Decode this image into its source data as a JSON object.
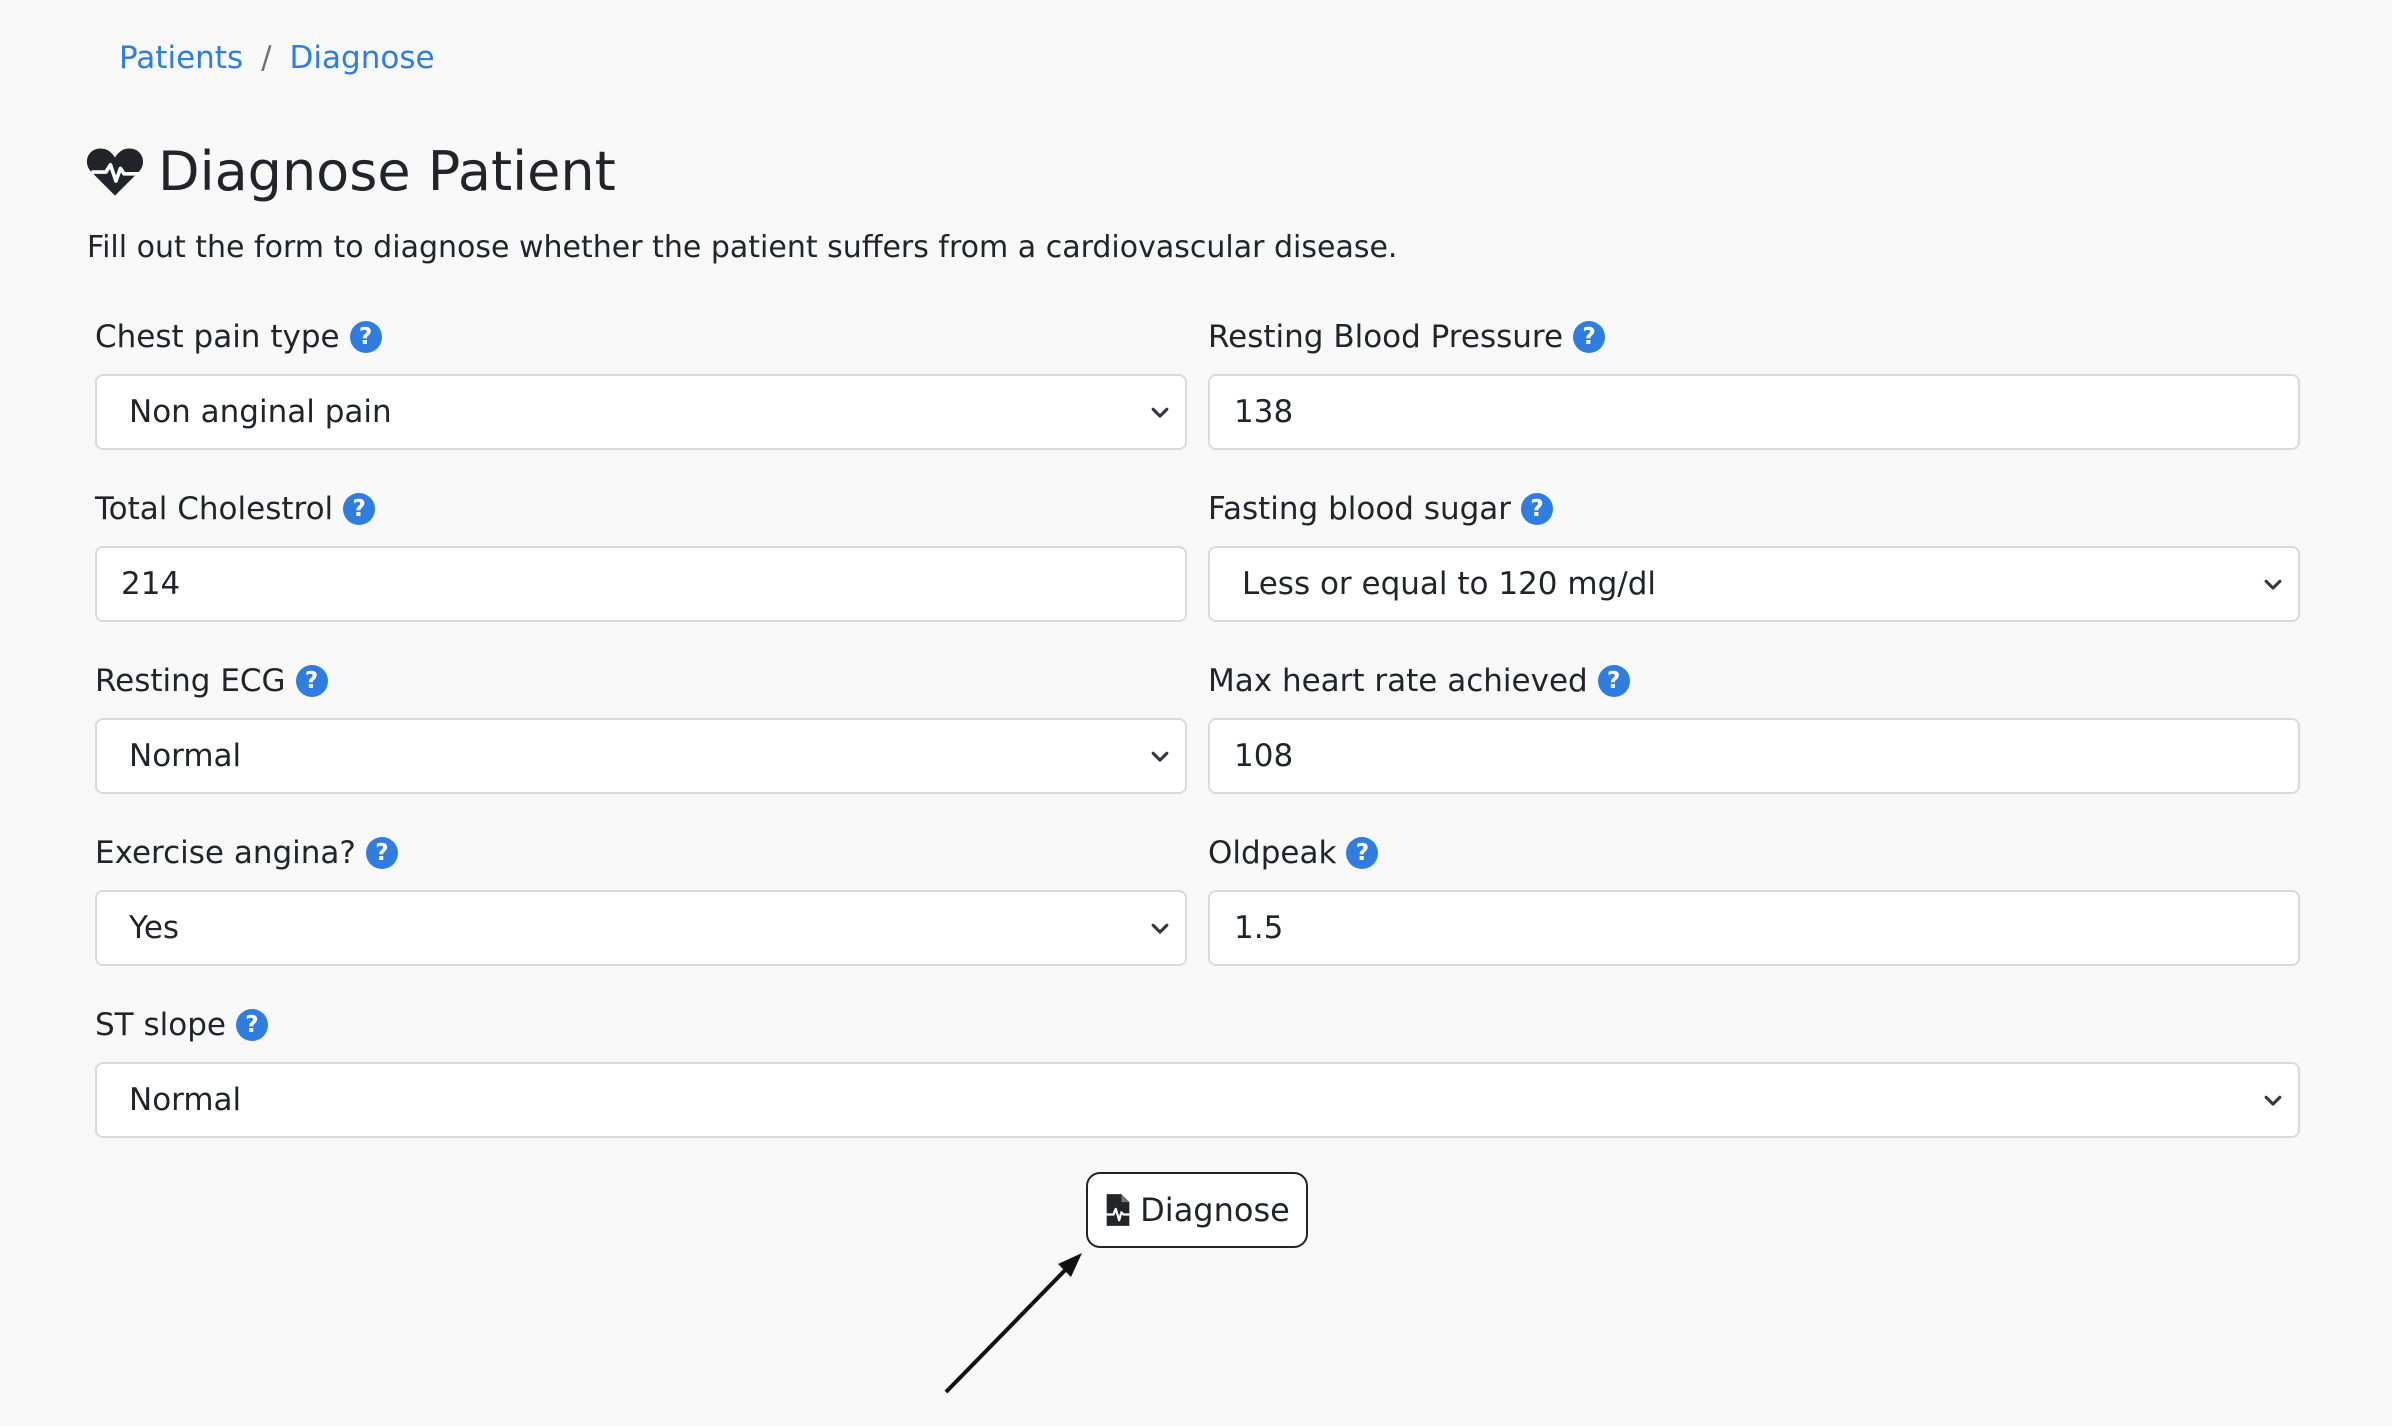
{
  "breadcrumb": {
    "items": [
      "Patients",
      "Diagnose"
    ],
    "separator": "/"
  },
  "page": {
    "title": "Diagnose Patient",
    "subtitle": "Fill out the form to diagnose whether the patient suffers from a cardiovascular disease.",
    "title_icon": "heart-pulse-icon"
  },
  "form": {
    "chest_pain": {
      "label": "Chest pain type",
      "value": "Non anginal pain"
    },
    "resting_bp": {
      "label": "Resting Blood Pressure",
      "value": "138"
    },
    "cholesterol": {
      "label": "Total Cholestrol",
      "value": "214"
    },
    "fasting_sugar": {
      "label": "Fasting blood sugar",
      "value": "Less or equal to 120 mg/dl"
    },
    "resting_ecg": {
      "label": "Resting ECG",
      "value": "Normal"
    },
    "max_hr": {
      "label": "Max heart rate achieved",
      "value": "108"
    },
    "exercise_angina": {
      "label": "Exercise angina?",
      "value": "Yes"
    },
    "oldpeak": {
      "label": "Oldpeak",
      "value": "1.5"
    },
    "st_slope": {
      "label": "ST slope",
      "value": "Normal"
    }
  },
  "actions": {
    "diagnose_label": "Diagnose",
    "diagnose_icon": "file-medical-icon"
  },
  "colors": {
    "accent": "#2f7de1",
    "background": "#f8f8f8",
    "text": "#212529",
    "border": "#d7dbe0"
  }
}
